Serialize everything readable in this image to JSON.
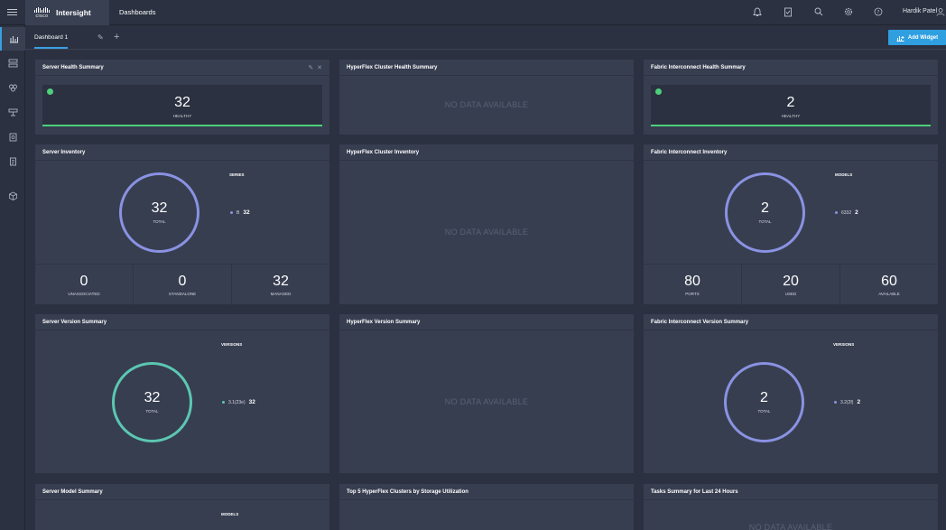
{
  "topbar": {
    "brand_mark": "cisco",
    "app_name": "Intersight",
    "page_title": "Dashboards",
    "user_name": "Hardik Patel",
    "icons": [
      "bell-icon",
      "tasks-icon",
      "search-icon",
      "gear-icon",
      "help-icon"
    ]
  },
  "tabs": {
    "active_label": "Dashboard 1",
    "add_widget_label": "Add Widget"
  },
  "widgets": {
    "server_health": {
      "title": "Server Health Summary",
      "count": "32",
      "label": "HEALTHY"
    },
    "hx_cluster_health": {
      "title": "HyperFlex Cluster Health Summary",
      "nodata": "NO DATA AVAILABLE"
    },
    "fi_health": {
      "title": "Fabric Interconnect Health Summary",
      "count": "2",
      "label": "HEALTHY"
    },
    "server_inventory": {
      "title": "Server Inventory",
      "total": "32",
      "total_label": "TOTAL",
      "legend_title": "SERIES",
      "legend_item": "B",
      "legend_value": "32",
      "stats": [
        {
          "value": "0",
          "label": "UNASSOCIATED"
        },
        {
          "value": "0",
          "label": "STANDALONE"
        },
        {
          "value": "32",
          "label": "MANAGED"
        }
      ]
    },
    "hx_cluster_inventory": {
      "title": "HyperFlex Cluster Inventory",
      "nodata": "NO DATA AVAILABLE"
    },
    "fi_inventory": {
      "title": "Fabric Interconnect Inventory",
      "total": "2",
      "total_label": "TOTAL",
      "legend_title": "MODELS",
      "legend_item": "6332",
      "legend_value": "2",
      "stats": [
        {
          "value": "80",
          "label": "PORTS"
        },
        {
          "value": "20",
          "label": "USED"
        },
        {
          "value": "60",
          "label": "AVAILABLE"
        }
      ]
    },
    "server_version": {
      "title": "Server Version Summary",
      "total": "32",
      "total_label": "TOTAL",
      "legend_title": "VERSIONS",
      "legend_item": "3.1(23e)",
      "legend_value": "32"
    },
    "hx_version": {
      "title": "HyperFlex Version Summary",
      "nodata": "NO DATA AVAILABLE"
    },
    "fi_version": {
      "title": "Fabric Interconnect Version Summary",
      "total": "2",
      "total_label": "TOTAL",
      "legend_title": "VERSIONS",
      "legend_item": "3.2(2f)",
      "legend_value": "2"
    },
    "server_model": {
      "title": "Server Model Summary",
      "legend_title": "MODELS"
    },
    "hx_top5": {
      "title": "Top 5 HyperFlex Clusters by Storage Utilization"
    },
    "tasks": {
      "title": "Tasks Summary for Last 24 Hours",
      "nodata": "NO DATA AVAILABLE"
    }
  },
  "colors": {
    "accent": "#2f9fe0",
    "healthy": "#4dd07a",
    "ring": "#8a92e2",
    "ring_teal": "#5cc7b2",
    "panel": "#373e50",
    "background": "#2b3140"
  }
}
